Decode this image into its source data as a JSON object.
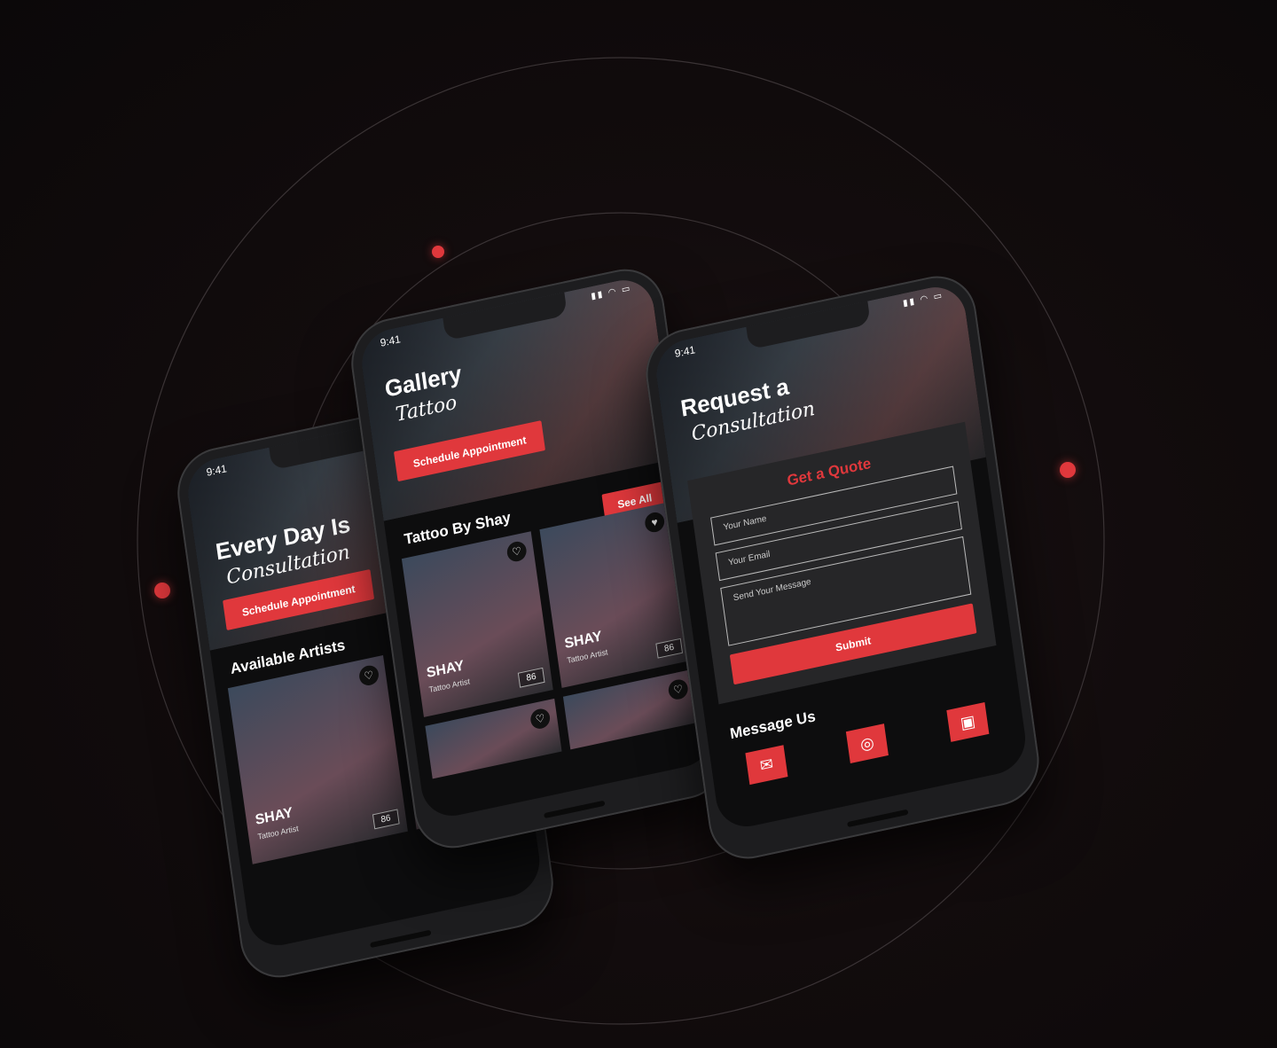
{
  "status_time": "9:41",
  "phones": {
    "home": {
      "hero_title": "Every Day Is",
      "hero_script": "Consultation",
      "cta": "Schedule Appointment",
      "section_title": "Available Artists",
      "card": {
        "name": "SHAY",
        "role": "Tattoo Artist",
        "likes": "86"
      }
    },
    "gallery": {
      "hero_title": "Gallery",
      "hero_script": "Tattoo",
      "cta": "Schedule Appointment",
      "section_title": "Tattoo By Shay",
      "see_all": "See All",
      "cards": [
        {
          "name": "SHAY",
          "role": "Tattoo Artist",
          "likes": "86"
        },
        {
          "name": "SHAY",
          "role": "Tattoo Artist",
          "likes": "86"
        }
      ]
    },
    "consult": {
      "hero_title": "Request a",
      "hero_script": "Consultation",
      "form_title": "Get a Quote",
      "name_placeholder": "Your Name",
      "email_placeholder": "Your Email",
      "message_placeholder": "Send Your Message",
      "submit": "Submit",
      "message_title": "Message Us",
      "socials": [
        "messenger-icon",
        "instagram-icon",
        "contact-icon"
      ]
    }
  },
  "colors": {
    "accent": "#e0383c",
    "background": "#120c0d",
    "panel": "#262628"
  }
}
